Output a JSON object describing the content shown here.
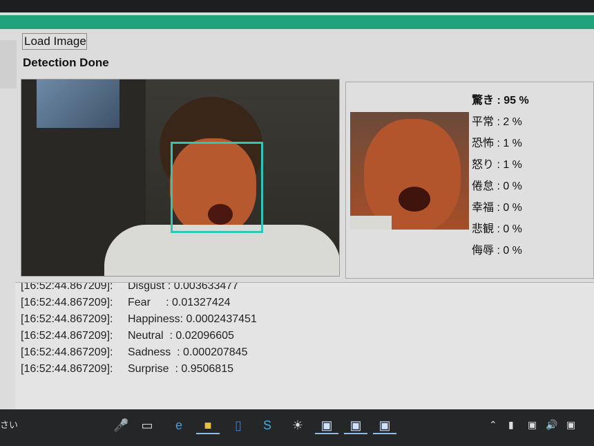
{
  "toolbar": {
    "load_label": "Load Image"
  },
  "status": {
    "text": "Detection Done"
  },
  "colors": {
    "accent": "#1ea37a",
    "face_box": "#2ec6b6"
  },
  "emotions": [
    {
      "label": "驚き : 95 %"
    },
    {
      "label": "平常 : 2 %"
    },
    {
      "label": "恐怖 : 1 %"
    },
    {
      "label": "怒り : 1 %"
    },
    {
      "label": "倦怠 : 0 %"
    },
    {
      "label": "幸福 : 0 %"
    },
    {
      "label": "悲観 : 0 %"
    },
    {
      "label": "侮辱 : 0 %"
    }
  ],
  "log": [
    {
      "ts": "[16:52:44.867209]:",
      "msg": "Disgust : 0.003633477"
    },
    {
      "ts": "[16:52:44.867209]:",
      "msg": "Fear     : 0.01327424"
    },
    {
      "ts": "[16:52:44.867209]:",
      "msg": "Happiness: 0.0002437451"
    },
    {
      "ts": "[16:52:44.867209]:",
      "msg": "Neutral  : 0.02096605"
    },
    {
      "ts": "[16:52:44.867209]:",
      "msg": "Sadness  : 0.000207845"
    },
    {
      "ts": "[16:52:44.867209]:",
      "msg": "Surprise  : 0.9506815"
    }
  ],
  "taskbar": {
    "search_fragment": "さい",
    "icons": [
      "microphone-icon",
      "task-view-icon",
      "edge-icon",
      "file-explorer-icon",
      "outlook-icon",
      "skype-icon",
      "app-icon",
      "window-icon",
      "window-icon",
      "window-icon"
    ],
    "tray_icons": [
      "chevron-up-icon",
      "battery-icon",
      "network-icon",
      "volume-icon",
      "notification-icon"
    ]
  }
}
